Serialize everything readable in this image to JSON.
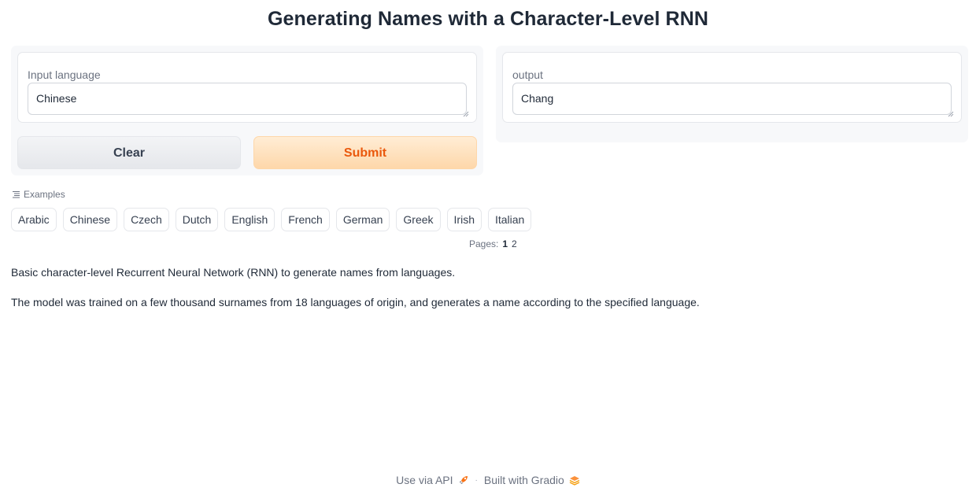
{
  "app": {
    "title": "Generating Names with a Character-Level RNN"
  },
  "input": {
    "label": "Input language",
    "value": "Chinese"
  },
  "output": {
    "label": "output",
    "value": "Chang"
  },
  "buttons": {
    "clear_label": "Clear",
    "submit_label": "Submit"
  },
  "examples": {
    "label": "Examples",
    "items": [
      "Arabic",
      "Chinese",
      "Czech",
      "Dutch",
      "English",
      "French",
      "German",
      "Greek",
      "Irish",
      "Italian"
    ],
    "pages_label": "Pages:",
    "pages": [
      "1",
      "2"
    ],
    "current_page": "1"
  },
  "description": {
    "line1": "Basic character-level Recurrent Neural Network (RNN) to generate names from languages.",
    "line2": "The model was trained on a few thousand surnames from 18 languages of origin, and generates a name according to the specified language."
  },
  "footer": {
    "api_label": "Use via API",
    "separator": "·",
    "built_label": "Built with Gradio"
  },
  "colors": {
    "accent": "#ea580c",
    "submit_bg": "#fed7aa",
    "panel_bg": "#f7f8fa"
  }
}
